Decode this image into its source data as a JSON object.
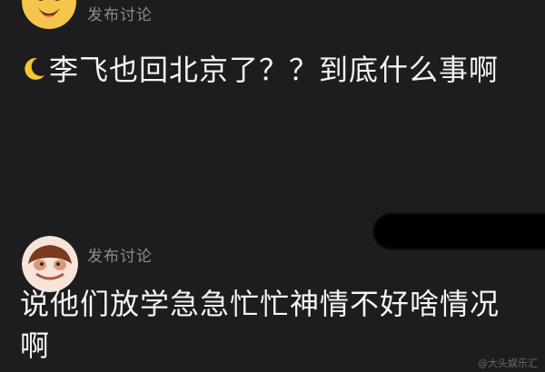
{
  "posts": [
    {
      "meta": "发布讨论",
      "text": "李飞也回北京了？？到底什么事啊"
    },
    {
      "meta": "发布讨论",
      "text": "说他们放学急急忙忙神情不好啥情况啊"
    }
  ],
  "watermark": "@大头娱乐汇",
  "colors": {
    "background": "#1d1d1f",
    "text": "#f4f4f4",
    "meta": "#8b8b8d",
    "moon": "#f6c531"
  },
  "icons": {
    "avatar_1": "emoji-avatar-icon",
    "avatar_2": "cartoon-avatar-icon",
    "moon": "crescent-moon-icon"
  }
}
